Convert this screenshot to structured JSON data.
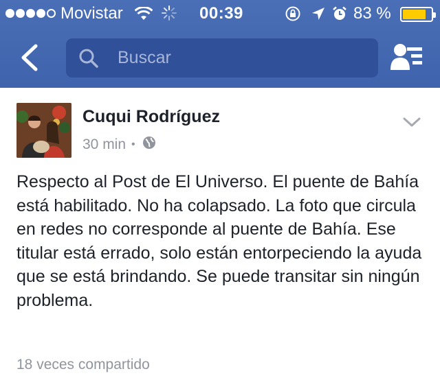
{
  "status_bar": {
    "carrier": "Movistar",
    "time": "00:39",
    "battery_percent": "83 %",
    "battery_level": 0.83,
    "signal_bars": 4,
    "icons": [
      "wifi-icon",
      "activity-spinner-icon",
      "rotation-lock-icon",
      "location-arrow-icon",
      "alarm-icon",
      "battery-icon"
    ]
  },
  "nav_bar": {
    "back_icon": "back-chevron-icon",
    "search_icon": "search-icon",
    "search_placeholder": "Buscar",
    "friends_icon": "friend-requests-icon"
  },
  "post": {
    "author": "Cuqui Rodríguez",
    "time_ago": "30 min",
    "separator": "•",
    "privacy_icon": "globe-icon",
    "menu_icon": "chevron-down-icon",
    "text": "Respecto al Post de El Universo. El puente de Bahía está habilitado. No ha colapsado. La foto que circula en redes no corresponde al puente de Bahía. Ese titular está errado, solo están entorpeciendo la ayuda que se está brindando. Se puede transitar sin ningún problema.",
    "shares": "18 veces compartido"
  },
  "colors": {
    "nav_blue": "#4267b2",
    "search_field": "#30509a",
    "text": "#1d2129",
    "muted": "#90949c",
    "battery_fill": "#ffcc00"
  }
}
